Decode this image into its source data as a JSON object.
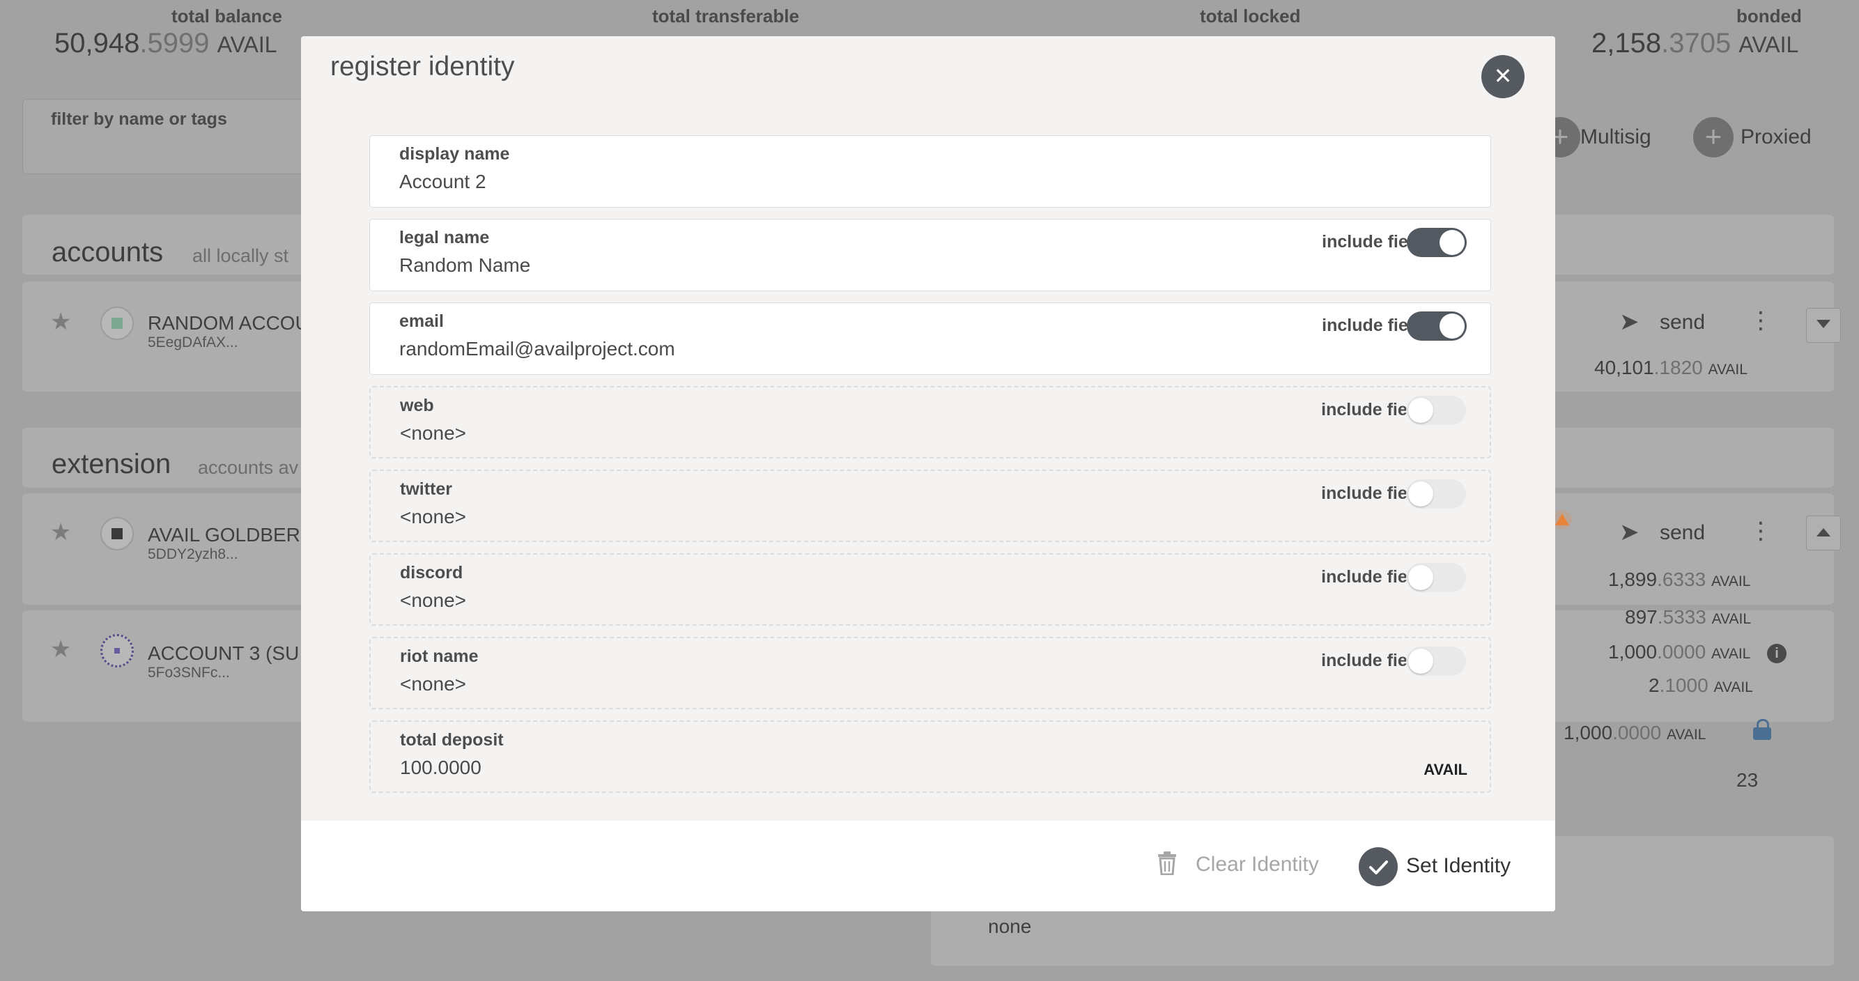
{
  "summary": {
    "total_balance": {
      "label": "total balance",
      "int": "50,948",
      "frac": ".5999",
      "unit": "AVAIL"
    },
    "total_transferable": {
      "label": "total transferable"
    },
    "total_locked": {
      "label": "total locked"
    },
    "bonded": {
      "label": "bonded",
      "int": "2,158",
      "frac": ".3705",
      "unit": "AVAIL"
    }
  },
  "filter": {
    "label": "filter by name or tags"
  },
  "top_actions": {
    "multisig": "Multisig",
    "proxied": "Proxied"
  },
  "accounts_section": {
    "title": "accounts",
    "subtitle": "all locally st",
    "items": [
      {
        "name": "RANDOM ACCOU",
        "address": "5EegDAfAX...",
        "send": "send",
        "balance": {
          "int": "40,101",
          "frac": ".1820",
          "unit": "AVAIL"
        }
      }
    ]
  },
  "extension_section": {
    "title": "extension",
    "subtitle": "accounts av",
    "items": [
      {
        "name": "AVAIL GOLDBERG",
        "address": "5DDY2yzh8...",
        "send": "send"
      },
      {
        "name": "ACCOUNT 3 (SU",
        "address": "5Fo3SNFc..."
      }
    ],
    "balances": [
      {
        "int": "1,899",
        "frac": ".6333",
        "unit": "AVAIL"
      },
      {
        "int": "897",
        "frac": ".5333",
        "unit": "AVAIL"
      },
      {
        "int": "1,000",
        "frac": ".0000",
        "unit": "AVAIL"
      },
      {
        "int": "2",
        "frac": ".1000",
        "unit": "AVAIL"
      },
      {
        "int": "1,000",
        "frac": ".0000",
        "unit": "AVAIL"
      }
    ],
    "count": "23",
    "none_text": "none"
  },
  "modal": {
    "title": "register identity",
    "include_label": "include field",
    "fields": {
      "display_name": {
        "label": "display name",
        "value": "Account 2"
      },
      "legal_name": {
        "label": "legal name",
        "value": "Random Name",
        "include": true
      },
      "email": {
        "label": "email",
        "value": "randomEmail@availproject.com",
        "include": true
      },
      "web": {
        "label": "web",
        "value": "<none>",
        "include": false
      },
      "twitter": {
        "label": "twitter",
        "value": "<none>",
        "include": false
      },
      "discord": {
        "label": "discord",
        "value": "<none>",
        "include": false
      },
      "riot_name": {
        "label": "riot name",
        "value": "<none>",
        "include": false
      },
      "total_deposit": {
        "label": "total deposit",
        "value": "100.0000",
        "unit": "AVAIL"
      }
    },
    "footer": {
      "clear_label": "Clear Identity",
      "set_label": "Set Identity"
    }
  },
  "colors": {
    "overlay_bg": "#a2a2a2",
    "modal_bg": "#f4f3f2",
    "toggle_on": "#535960",
    "warning": "#e8833a",
    "lock": "#4b6f93"
  }
}
